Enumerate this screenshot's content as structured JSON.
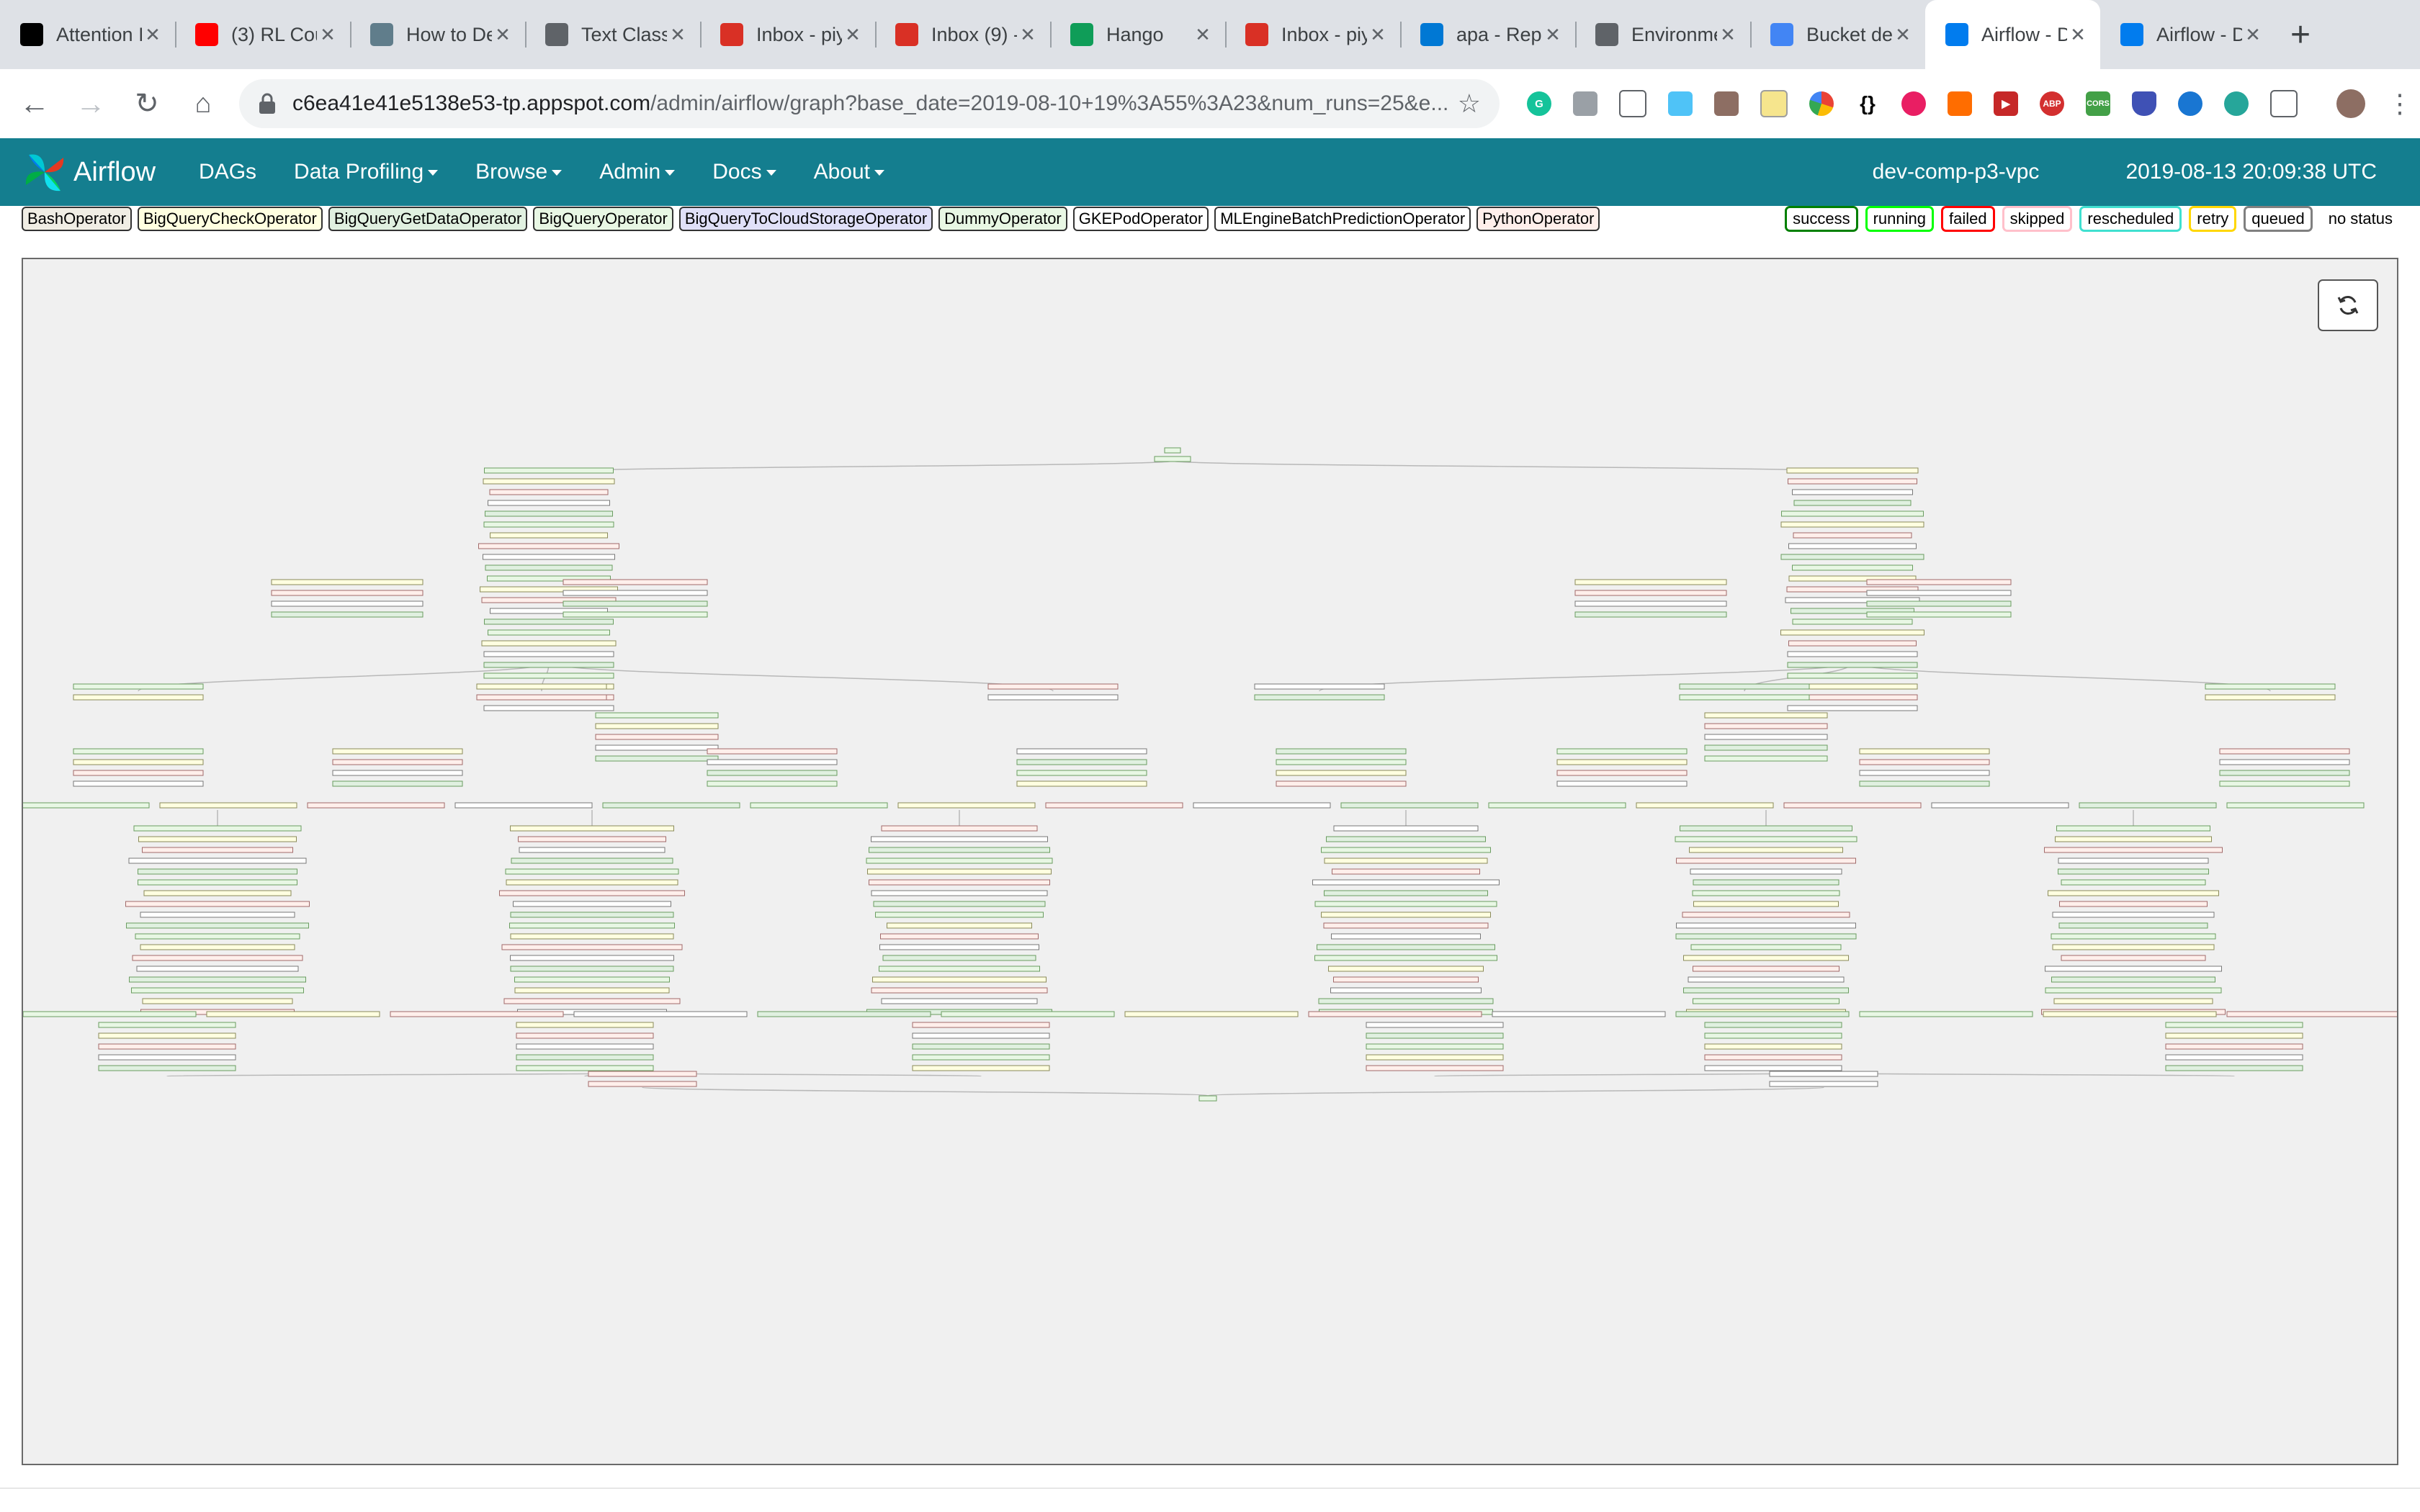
{
  "browser": {
    "tabs": [
      {
        "title": "Attention I",
        "icon": "medium-icon",
        "color": "#000000"
      },
      {
        "title": "(3) RL Cou",
        "icon": "youtube-icon",
        "color": "#ff0000"
      },
      {
        "title": "How to De",
        "icon": "site-thumbnail-icon",
        "color": "#607d8b"
      },
      {
        "title": "Text Class",
        "icon": "globe-icon",
        "color": "#5f6368"
      },
      {
        "title": "Inbox - piy",
        "icon": "gmail-icon",
        "color": "#d93025"
      },
      {
        "title": "Inbox (9) -",
        "icon": "gmail-icon",
        "color": "#d93025"
      },
      {
        "title": "Hango",
        "icon": "hangouts-icon",
        "color": "#0f9d58"
      },
      {
        "title": "Inbox - piy",
        "icon": "gmail-icon",
        "color": "#d93025"
      },
      {
        "title": "apa - Repo",
        "icon": "azure-devops-icon",
        "color": "#0078d4"
      },
      {
        "title": "Environme",
        "icon": "gear-icon",
        "color": "#5f6368"
      },
      {
        "title": "Bucket de",
        "icon": "storage-icon",
        "color": "#4285f4"
      },
      {
        "title": "Airflow - D",
        "icon": "airflow-icon",
        "color": "#017cee",
        "active": true
      },
      {
        "title": "Airflow - D",
        "icon": "airflow-icon",
        "color": "#017cee"
      }
    ],
    "url_host": "c6ea41e41e5138e53-tp.appspot.com",
    "url_path": "/admin/airflow/graph?base_date=2019-08-10+19%3A55%3A23&num_runs=25&e..."
  },
  "airflow": {
    "brand": "Airflow",
    "menu": [
      {
        "label": "DAGs",
        "dropdown": false
      },
      {
        "label": "Data Profiling",
        "dropdown": true
      },
      {
        "label": "Browse",
        "dropdown": true
      },
      {
        "label": "Admin",
        "dropdown": true
      },
      {
        "label": "Docs",
        "dropdown": true
      },
      {
        "label": "About",
        "dropdown": true
      }
    ],
    "environment": "dev-comp-p3-vpc",
    "clock": "2019-08-13 20:09:38 UTC"
  },
  "operators": [
    {
      "label": "BashOperator",
      "color": "#f0ede4"
    },
    {
      "label": "BigQueryCheckOperator",
      "color": "#ffffe0"
    },
    {
      "label": "BigQueryGetDataOperator",
      "color": "#e0f0e0"
    },
    {
      "label": "BigQueryOperator",
      "color": "#e8f7e4"
    },
    {
      "label": "BigQueryToCloudStorageOperator",
      "color": "#e0e0f8"
    },
    {
      "label": "DummyOperator",
      "color": "#e8f7e4"
    },
    {
      "label": "GKEPodOperator",
      "color": "#ffffff"
    },
    {
      "label": "MLEngineBatchPredictionOperator",
      "color": "#ffffff"
    },
    {
      "label": "PythonOperator",
      "color": "#ffefeb"
    }
  ],
  "states": [
    {
      "label": "success",
      "border": "#008000"
    },
    {
      "label": "running",
      "border": "#00ff00"
    },
    {
      "label": "failed",
      "border": "#ff0000"
    },
    {
      "label": "skipped",
      "border": "#ffc0cb"
    },
    {
      "label": "rescheduled",
      "border": "#40e0d0"
    },
    {
      "label": "retry",
      "border": "#ffd700"
    },
    {
      "label": "queued",
      "border": "#808080"
    }
  ],
  "no_status_label": "no status",
  "graph": {
    "refresh_icon": "refresh-icon"
  }
}
